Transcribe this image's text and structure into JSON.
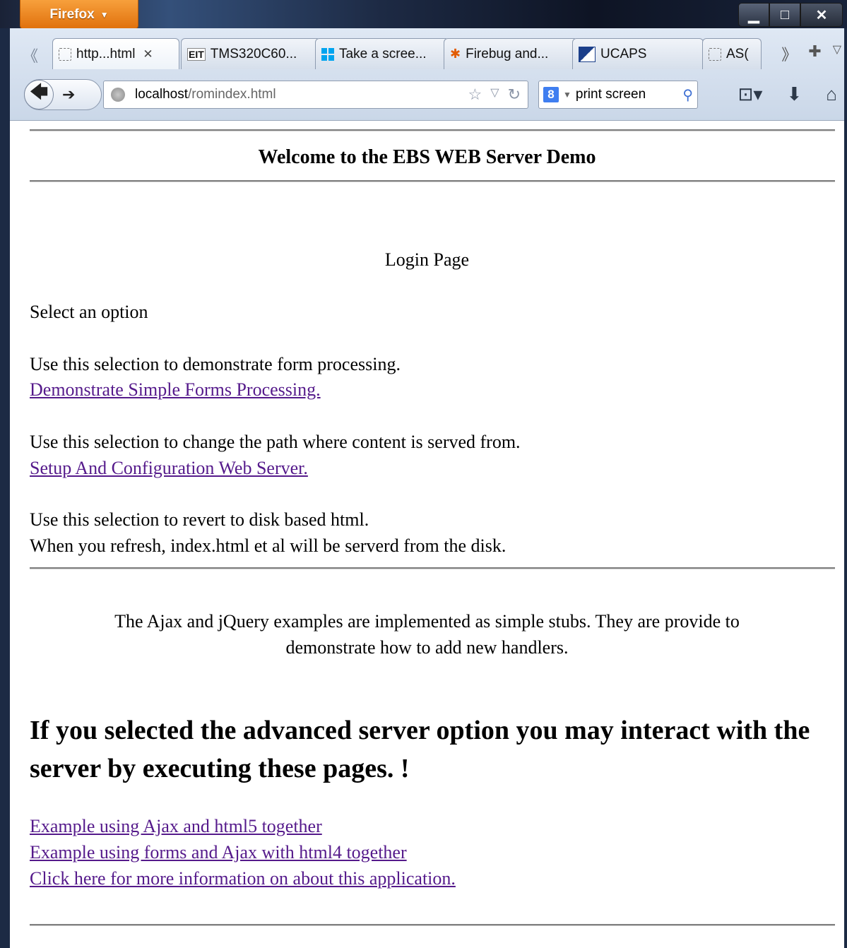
{
  "browser": {
    "firefox_button_label": "Firefox",
    "tabs": [
      {
        "label": "http...html"
      },
      {
        "label": "TMS320C60..."
      },
      {
        "label": "Take a scree..."
      },
      {
        "label": "Firebug and..."
      },
      {
        "label": "UCAPS"
      },
      {
        "label": "AS("
      }
    ],
    "url_host": "localhost",
    "url_path": "/romindex.html",
    "search_value": "print screen"
  },
  "page": {
    "title": "Welcome to the EBS WEB Server Demo",
    "login_label": "Login Page",
    "select_option": "Select an option",
    "form_desc": "Use this selection to demonstrate form processing.",
    "form_link": "Demonstrate Simple Forms Processing.",
    "path_desc": "Use this selection to change the path where content is served from.",
    "setup_link": "Setup And Configuration Web Server.",
    "revert_desc": "Use this selection to revert to disk based html.",
    "refresh_desc": "When you refresh, index.html et al will be serverd from the disk.",
    "ajax_note_line1": "The Ajax and jQuery examples are implemented as simple stubs. They are provide to",
    "ajax_note_line2": "demonstrate how to add new handlers.",
    "advanced_heading": "If you selected the advanced server option you may interact with the server by executing these pages. !",
    "links": [
      "Example using Ajax and html5 together",
      "Example using forms and Ajax with html4 together",
      "Click here for more information on about this application."
    ]
  }
}
